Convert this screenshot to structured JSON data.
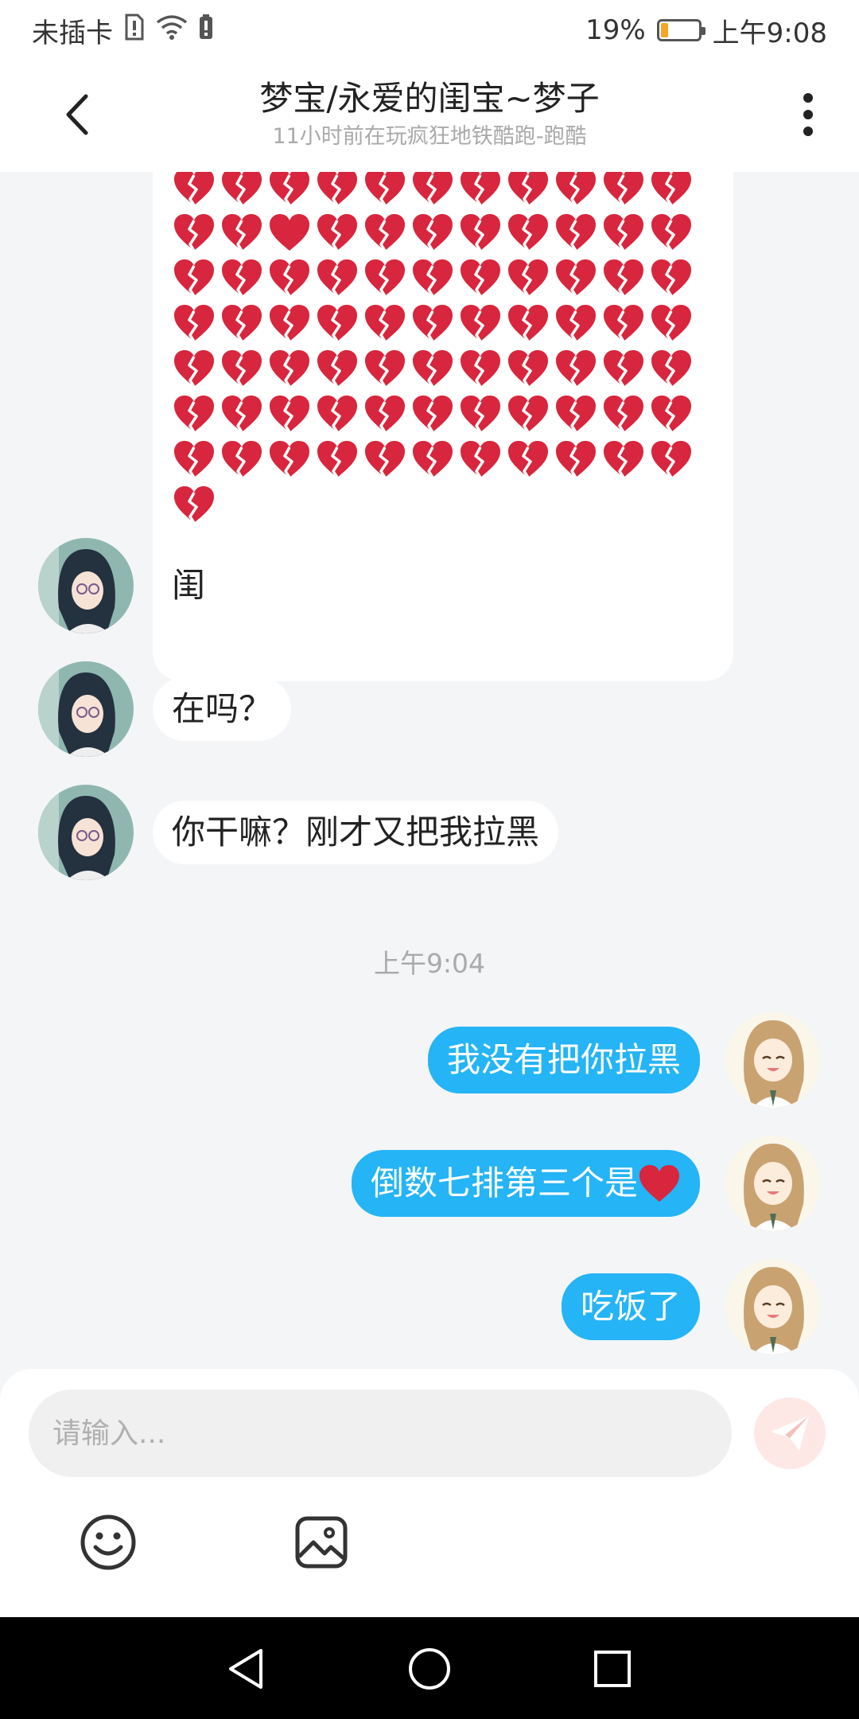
{
  "status_bar": {
    "carrier": "未插卡",
    "battery_percent": "19%",
    "battery_level": 0.19,
    "time": "上午9:08"
  },
  "header": {
    "title": "梦宝/永爱的闺宝~梦子",
    "subtitle": "11小时前在玩疯狂地铁酷跑-跑酷"
  },
  "chat": {
    "heart_message": {
      "broken_heart_count": 78,
      "red_heart_position": "倒数七排第三个",
      "colors": {
        "heart": "#d7263d"
      }
    },
    "incoming": [
      {
        "text": "闺"
      },
      {
        "text": "在吗？"
      },
      {
        "text": "你干嘛？刚才又把我拉黑"
      }
    ],
    "time_separator": "上午9:04",
    "outgoing": [
      {
        "text": "我没有把你拉黑"
      },
      {
        "text": "倒数七排第三个是",
        "emoji": "red-heart"
      },
      {
        "text": "吃饭了"
      }
    ]
  },
  "input": {
    "placeholder": "请输入..."
  },
  "icons": {
    "back": "back-arrow-icon",
    "more": "more-vertical-icon",
    "send": "send-icon",
    "emoji": "emoji-smile-icon",
    "image": "image-icon"
  },
  "colors": {
    "outgoing_bubble": "#25b4f5",
    "incoming_bubble": "#ffffff",
    "background": "#f4f5f7",
    "send_button": "#f7a39a"
  }
}
